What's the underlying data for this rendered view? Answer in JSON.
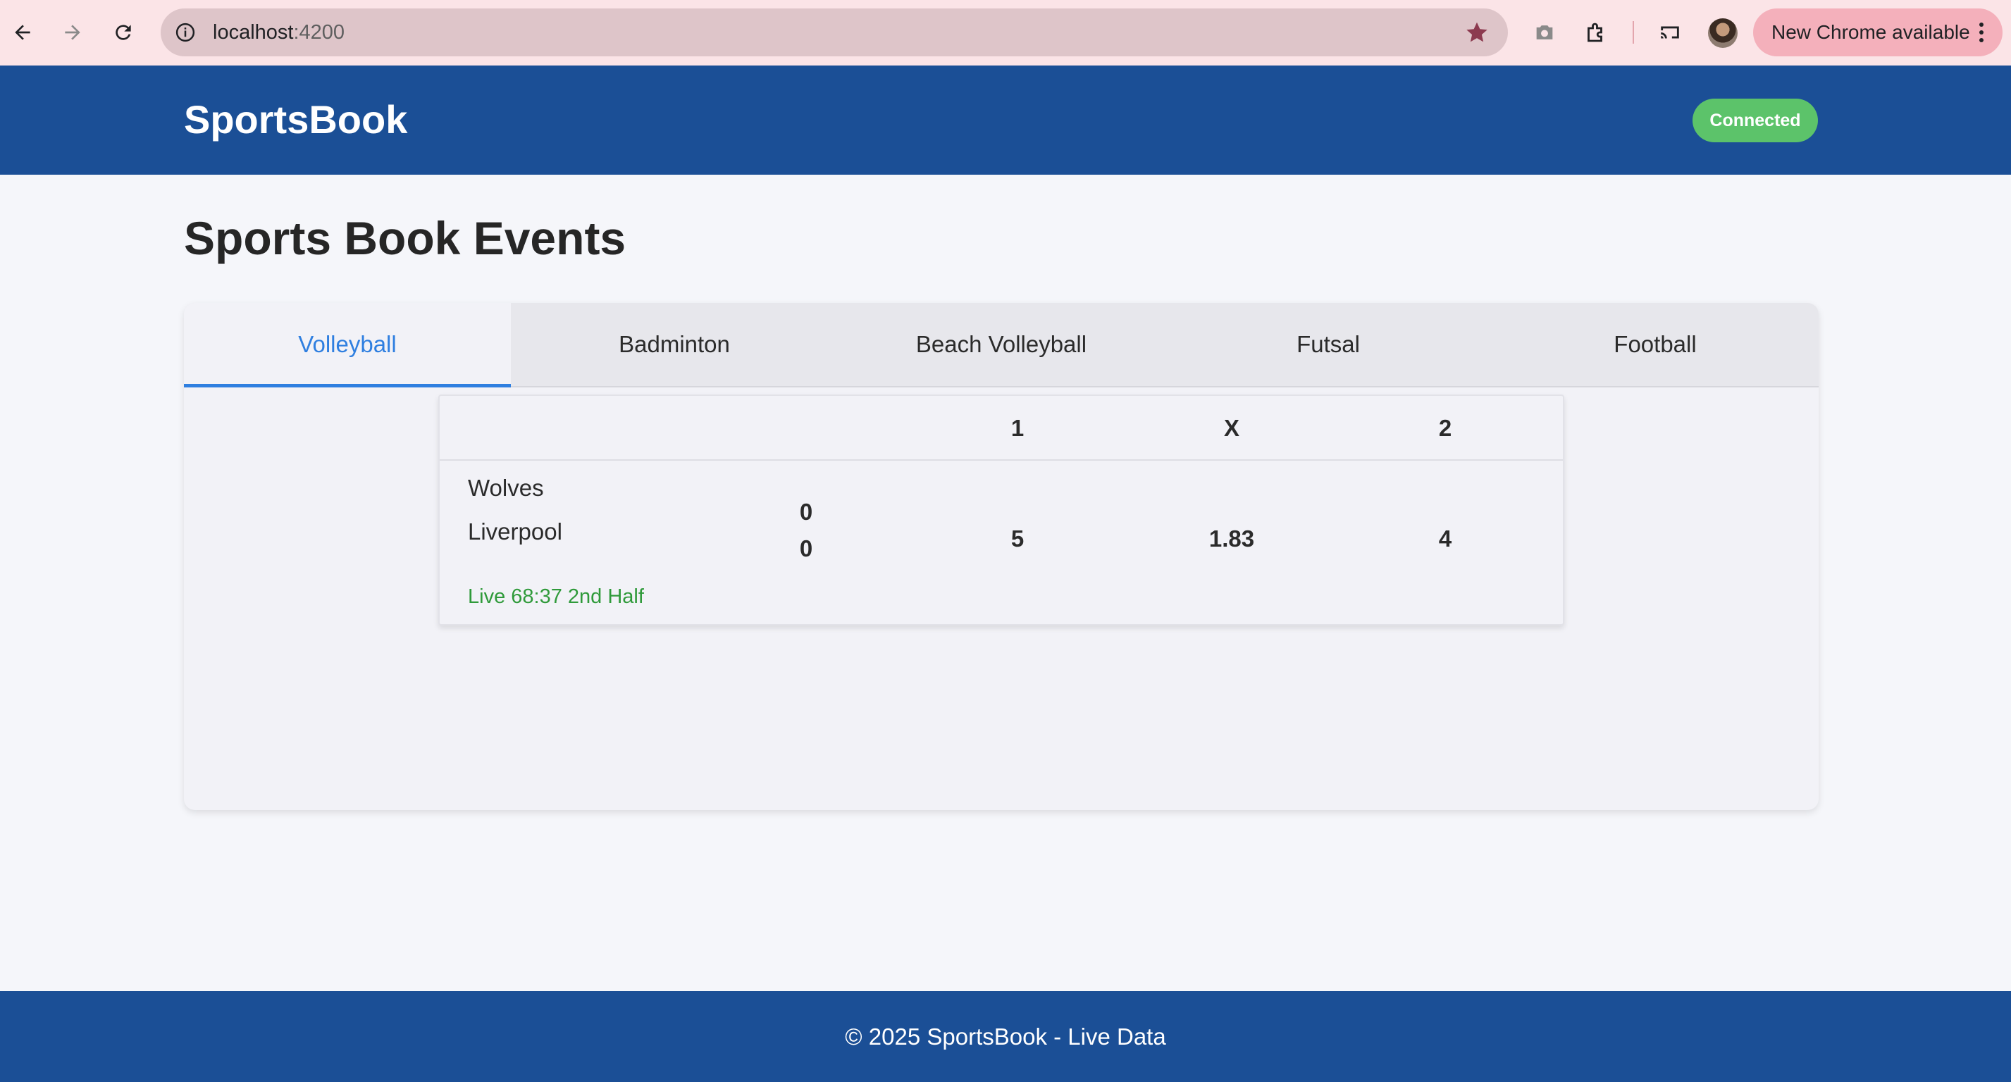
{
  "browser": {
    "url_host": "localhost",
    "url_port": ":4200",
    "update_chip": "New Chrome available"
  },
  "app": {
    "brand": "SportsBook",
    "status": "Connected"
  },
  "main": {
    "title": "Sports Book Events",
    "tabs": [
      {
        "label": "Volleyball",
        "active": true
      },
      {
        "label": "Badminton",
        "active": false
      },
      {
        "label": "Beach Volleyball",
        "active": false
      },
      {
        "label": "Futsal",
        "active": false
      },
      {
        "label": "Football",
        "active": false
      }
    ],
    "table": {
      "headers": [
        "1",
        "X",
        "2"
      ],
      "events": [
        {
          "home": "Wolves",
          "away": "Liverpool",
          "home_score": "0",
          "away_score": "0",
          "status": "Live 68:37 2nd Half",
          "odds": [
            "5",
            "1.83",
            "4"
          ]
        }
      ]
    }
  },
  "footer": {
    "text": "© 2025 SportsBook - Live Data"
  },
  "colors": {
    "header_bg": "#1b4f96",
    "accent": "#2f7fe0",
    "connected": "#5cc36a",
    "live": "#2f9a3a"
  }
}
